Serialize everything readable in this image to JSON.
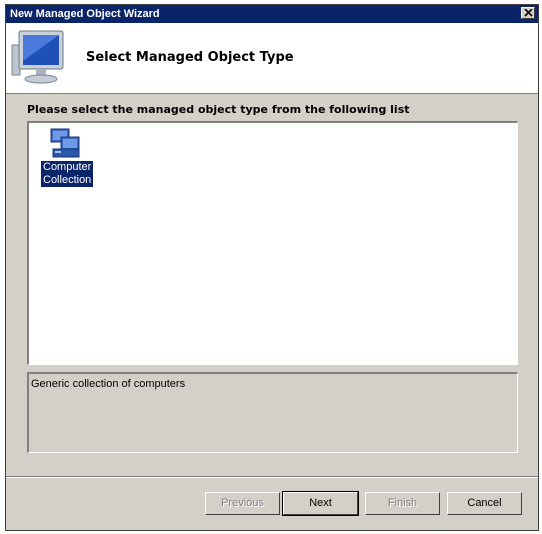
{
  "window": {
    "title": "New Managed Object Wizard"
  },
  "header": {
    "title": "Select Managed Object Type",
    "icon": "computer-monitor-icon"
  },
  "prompt": "Please select the managed object type from the following list",
  "list": {
    "items": [
      {
        "label": "Computer Collection",
        "label_line1": "Computer",
        "label_line2": "Collection",
        "icon": "computer-collection-icon",
        "selected": true
      }
    ]
  },
  "description": "Generic collection of computers",
  "buttons": {
    "previous": "Previous",
    "next": "Next",
    "finish": "Finish",
    "cancel": "Cancel"
  },
  "colors": {
    "titlebar": "#0a246a",
    "face": "#d4d0c8",
    "selection": "#0a246a"
  }
}
